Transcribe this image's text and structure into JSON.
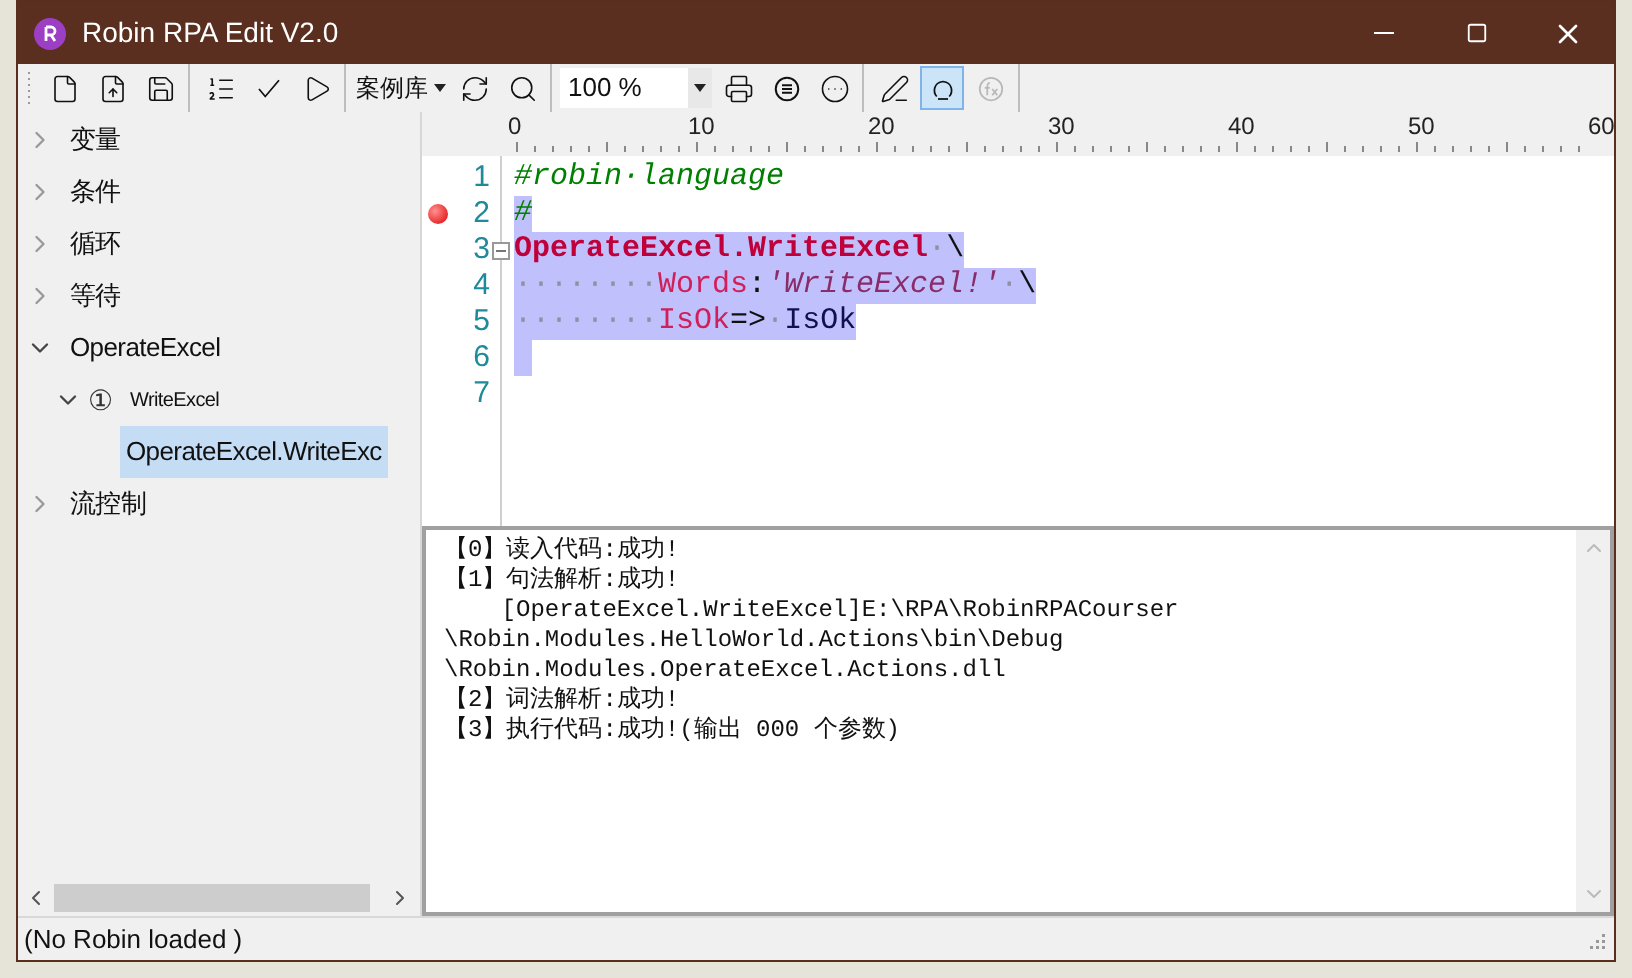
{
  "window": {
    "title": "Robin RPA Edit V2.0"
  },
  "toolbar": {
    "groups": [
      [
        {
          "kind": "button",
          "pressed": false,
          "disabled": false
        },
        {
          "kind": "button",
          "pressed": false,
          "disabled": false
        },
        {
          "kind": "button",
          "pressed": false,
          "disabled": false
        }
      ],
      [
        {
          "kind": "button",
          "pressed": false,
          "disabled": false
        },
        {
          "kind": "button",
          "pressed": false,
          "disabled": false
        },
        {
          "kind": "button",
          "pressed": false,
          "disabled": false
        }
      ],
      [
        {
          "kind": "dropdown",
          "label": "案例库"
        },
        {
          "kind": "button",
          "pressed": false,
          "disabled": false
        },
        {
          "kind": "button",
          "pressed": false,
          "disabled": false
        }
      ],
      [
        {
          "kind": "zoom",
          "value": "100 %"
        },
        {
          "kind": "button",
          "pressed": false,
          "disabled": false
        },
        {
          "kind": "button",
          "pressed": false,
          "disabled": false
        },
        {
          "kind": "button",
          "pressed": false,
          "disabled": false
        }
      ],
      [
        {
          "kind": "button",
          "pressed": false,
          "disabled": false
        },
        {
          "kind": "button",
          "pressed": true,
          "disabled": false
        },
        {
          "kind": "button",
          "pressed": false,
          "disabled": true
        }
      ]
    ]
  },
  "tree": {
    "items": [
      {
        "label": "变量",
        "expanded": false
      },
      {
        "label": "条件",
        "expanded": false
      },
      {
        "label": "循环",
        "expanded": false
      },
      {
        "label": "等待",
        "expanded": false
      },
      {
        "label": "OperateExcel",
        "expanded": true,
        "children": [
          {
            "label": "WriteExcel",
            "marker": "①",
            "expanded": true,
            "children": [
              {
                "label": "OperateExcel.WriteExc",
                "selected": true
              }
            ]
          }
        ]
      },
      {
        "label": "流控制",
        "expanded": false
      }
    ]
  },
  "editor": {
    "ruler": [
      "0",
      "10",
      "20",
      "30",
      "40",
      "50",
      "60"
    ],
    "lines": [
      {
        "number": "1",
        "breakpoint": false,
        "selected": false,
        "fold": false,
        "tokens": [
          {
            "kind": "comment",
            "text": "#robin·language"
          }
        ]
      },
      {
        "number": "2",
        "breakpoint": true,
        "selected": true,
        "fold": false,
        "tokens": [
          {
            "kind": "comment",
            "text": "#"
          }
        ]
      },
      {
        "number": "3",
        "breakpoint": false,
        "selected": true,
        "fold": true,
        "tokens": [
          {
            "kind": "keyword",
            "text": "OperateExcel.WriteExcel"
          },
          {
            "kind": "ws",
            "text": "·"
          },
          {
            "kind": "op",
            "text": "\\"
          }
        ]
      },
      {
        "number": "4",
        "breakpoint": false,
        "selected": true,
        "fold": false,
        "tokens": [
          {
            "kind": "ws",
            "text": "········"
          },
          {
            "kind": "param",
            "text": "Words"
          },
          {
            "kind": "op",
            "text": ":"
          },
          {
            "kind": "string",
            "text": "'WriteExcel!'"
          },
          {
            "kind": "ws",
            "text": "·"
          },
          {
            "kind": "op",
            "text": "\\"
          }
        ]
      },
      {
        "number": "5",
        "breakpoint": false,
        "selected": true,
        "fold": false,
        "tokens": [
          {
            "kind": "ws",
            "text": "········"
          },
          {
            "kind": "param",
            "text": "IsOk"
          },
          {
            "kind": "op",
            "text": "=>"
          },
          {
            "kind": "ws",
            "text": "·"
          },
          {
            "kind": "ident",
            "text": "IsOk"
          }
        ]
      },
      {
        "number": "6",
        "breakpoint": false,
        "selected": true,
        "fold": false
      },
      {
        "number": "7",
        "breakpoint": false,
        "selected": false,
        "fold": false
      }
    ]
  },
  "output": {
    "lines": [
      "【0】读入代码:成功!",
      "【1】句法解析:成功!",
      "    [OperateExcel.WriteExcel]E:\\RPA\\RobinRPACourser",
      "\\Robin.Modules.HelloWorld.Actions\\bin\\Debug",
      "\\Robin.Modules.OperateExcel.Actions.dll",
      "【2】词法解析:成功!",
      "【3】执行代码:成功!(输出 000 个参数)"
    ]
  },
  "status_bar": {
    "text": "(No Robin loaded )"
  }
}
